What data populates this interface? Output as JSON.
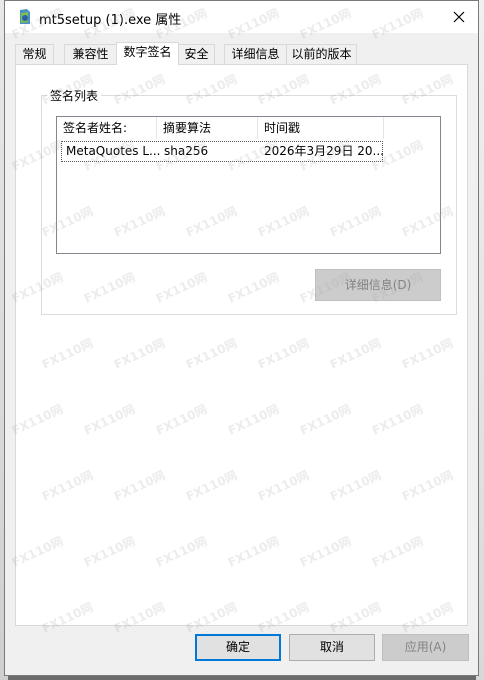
{
  "window": {
    "title": "mt5setup (1).exe 属性"
  },
  "tabs": [
    {
      "label": "常规",
      "active": false
    },
    {
      "label": "兼容性",
      "active": false
    },
    {
      "label": "数字签名",
      "active": true
    },
    {
      "label": "安全",
      "active": false
    },
    {
      "label": "详细信息",
      "active": false
    },
    {
      "label": "以前的版本",
      "active": false
    }
  ],
  "signature_list": {
    "group_label": "签名列表",
    "columns": [
      "签名者姓名:",
      "摘要算法",
      "时间戳"
    ],
    "rows": [
      {
        "signer": "MetaQuotes L...",
        "digest": "sha256",
        "timestamp": "2026年3月29日 20..."
      }
    ],
    "details_button": "详细信息(D)"
  },
  "footer": {
    "ok": "确定",
    "cancel": "取消",
    "apply": "应用(A)"
  },
  "watermark_text": "FX110网"
}
